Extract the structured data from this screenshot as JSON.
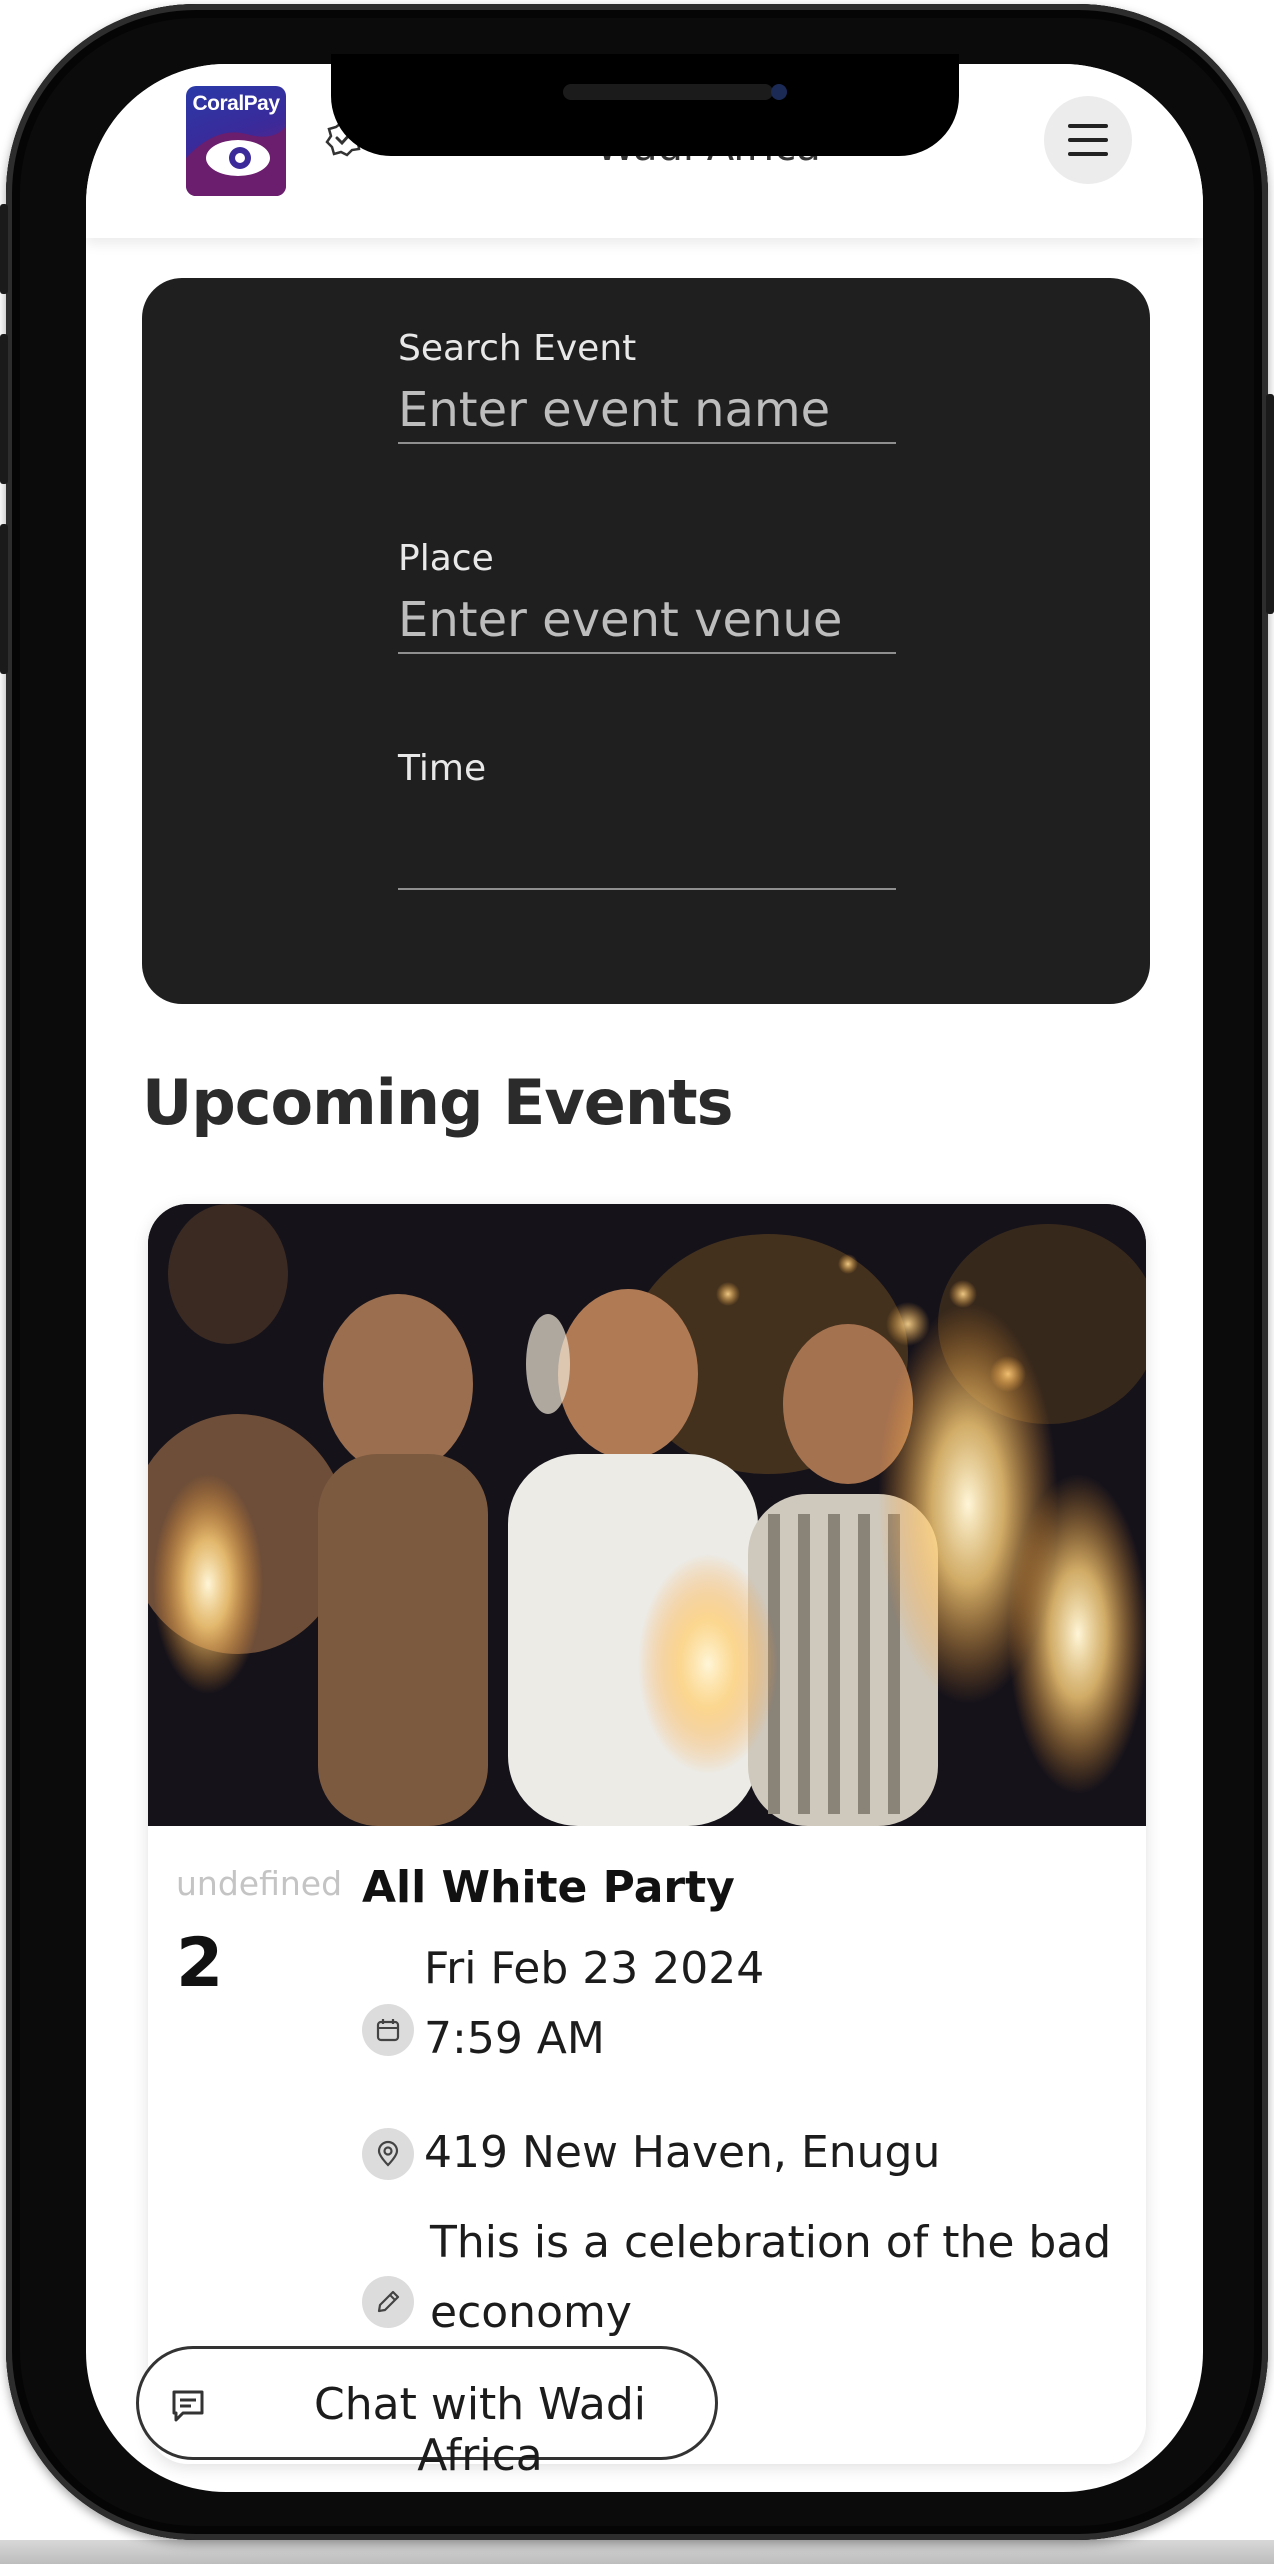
{
  "header": {
    "logo_text": "CoralPay",
    "brand_name": "Wadi Africa",
    "menu_icon": "hamburger-menu-icon",
    "verify_icon": "verified-badge-icon"
  },
  "search": {
    "event_label": "Search Event",
    "event_placeholder": "Enter event name",
    "place_label": "Place",
    "place_placeholder": "Enter event venue",
    "time_label": "Time",
    "time_value": ""
  },
  "section": {
    "title": "Upcoming Events"
  },
  "events": [
    {
      "image_alt": "party people holding sparklers",
      "day_month": "undefined",
      "day_number": "2",
      "title": "All White Party",
      "date": "Fri Feb 23 2024",
      "time": "7:59 AM",
      "location": "419 New Haven, Enugu",
      "description_line1": "This is a celebration of the bad",
      "description_line2": "economy",
      "icons": [
        "calendar-icon",
        "location-pin-icon",
        "pencil-icon"
      ]
    }
  ],
  "chat": {
    "label": "Chat with Wadi Africa",
    "icon": "chat-bubble-icon"
  },
  "colors": {
    "search_card_bg": "#1f1f1f",
    "logo_blue": "#2a3aa8",
    "logo_purple": "#7a1f7a"
  }
}
